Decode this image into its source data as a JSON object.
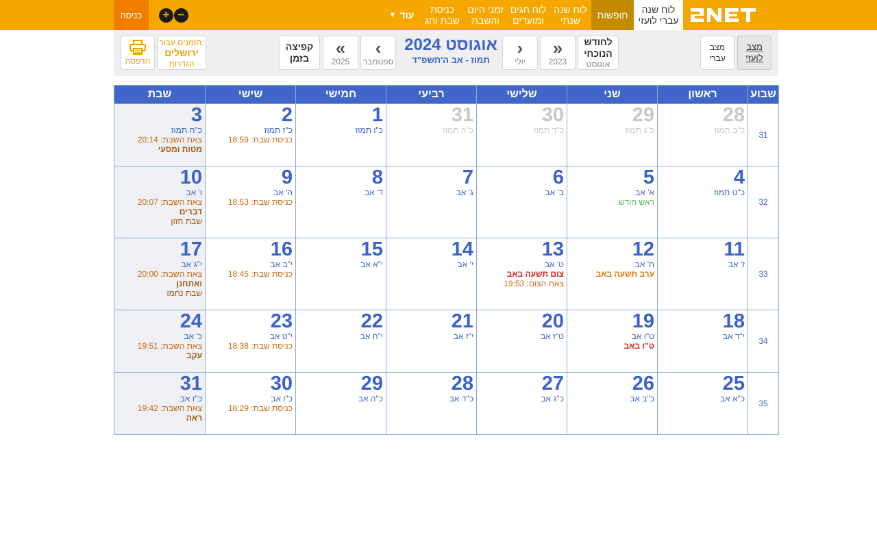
{
  "nav": {
    "items": [
      {
        "label_line1": "לוח שנה",
        "label_line2": "עברי לועזי"
      },
      {
        "label_line1": "חופשות",
        "label_line2": ""
      },
      {
        "label_line1": "לוח שנה",
        "label_line2": "שנתי"
      },
      {
        "label_line1": "לוח חגים",
        "label_line2": "ומועדים"
      },
      {
        "label_line1": "זמני היום",
        "label_line2": "והשבת"
      },
      {
        "label_line1": "כניסת",
        "label_line2": "שבת וחג"
      }
    ],
    "more_label": "עוד",
    "login_label": "כניסה",
    "zoom_in": "+",
    "zoom_out": "−"
  },
  "toolbar": {
    "mode_gregorian": {
      "line1": "מצב",
      "line2": "לועזי"
    },
    "mode_hebrew": {
      "line1": "מצב",
      "line2": "עברי"
    },
    "current_month": {
      "line1": "לחודש",
      "line2": "הנוכחי",
      "sub": "אוגוסט"
    },
    "prev_year": {
      "label": "2023"
    },
    "prev_month": {
      "label": "יולי"
    },
    "month_title": "אוגוסט 2024",
    "hebrew_range": "תמוז - אב ה'תשפ\"ד",
    "next_month": {
      "label": "ספטמבר"
    },
    "next_year": {
      "label": "2025"
    },
    "jump": {
      "line1": "קפיצה",
      "line2": "בזמן"
    },
    "location": {
      "line1": "הזמנים עבור:",
      "line2": "ירושלים",
      "line3": "הגדרות"
    },
    "print_label": "הדפסה"
  },
  "calendar": {
    "headers": [
      "שבוע",
      "ראשון",
      "שני",
      "שלישי",
      "רביעי",
      "חמישי",
      "שישי",
      "שבת"
    ],
    "weeks": [
      {
        "week": "31",
        "days": [
          {
            "num": "28",
            "heb": "כ\"ב תמוז",
            "out": true,
            "events": []
          },
          {
            "num": "29",
            "heb": "כ\"ג תמוז",
            "out": true,
            "events": []
          },
          {
            "num": "30",
            "heb": "כ\"ד תמוז",
            "out": true,
            "events": []
          },
          {
            "num": "31",
            "heb": "כ\"ה תמוז",
            "out": true,
            "events": []
          },
          {
            "num": "1",
            "heb": "כ\"ו תמוז",
            "out": false,
            "events": []
          },
          {
            "num": "2",
            "heb": "כ\"ז תמוז",
            "out": false,
            "events": [
              {
                "text": "כניסת שבת: 18:59",
                "style": "orange"
              }
            ]
          },
          {
            "num": "3",
            "heb": "כ\"ח תמוז",
            "out": false,
            "events": [
              {
                "text": "צאת השבת: 20:14",
                "style": "orange"
              },
              {
                "text": "מטות ומסעי",
                "style": "parasha"
              }
            ]
          }
        ]
      },
      {
        "week": "32",
        "days": [
          {
            "num": "4",
            "heb": "כ\"ט תמוז",
            "out": false,
            "events": []
          },
          {
            "num": "5",
            "heb": "א' אב",
            "out": false,
            "events": [
              {
                "text": "ראש חודש",
                "style": "green"
              }
            ]
          },
          {
            "num": "6",
            "heb": "ב' אב",
            "out": false,
            "events": []
          },
          {
            "num": "7",
            "heb": "ג' אב",
            "out": false,
            "events": []
          },
          {
            "num": "8",
            "heb": "ד' אב",
            "out": false,
            "events": []
          },
          {
            "num": "9",
            "heb": "ה' אב",
            "out": false,
            "events": [
              {
                "text": "כניסת שבת: 18:53",
                "style": "orange"
              }
            ]
          },
          {
            "num": "10",
            "heb": "ו' אב",
            "out": false,
            "events": [
              {
                "text": "צאת השבת: 20:07",
                "style": "orange"
              },
              {
                "text": "דברים",
                "style": "parasha"
              },
              {
                "text": "שבת חזון",
                "style": "brown"
              }
            ]
          }
        ]
      },
      {
        "week": "33",
        "days": [
          {
            "num": "11",
            "heb": "ז' אב",
            "out": false,
            "events": []
          },
          {
            "num": "12",
            "heb": "ח' אב",
            "out": false,
            "events": [
              {
                "text": "ערב תשעה באב",
                "style": "orangebold"
              }
            ]
          },
          {
            "num": "13",
            "heb": "ט' אב",
            "out": false,
            "events": [
              {
                "text": "צום תשעה באב",
                "style": "red"
              },
              {
                "text": "צאת הצום: 19:53",
                "style": "orange"
              }
            ]
          },
          {
            "num": "14",
            "heb": "י' אב",
            "out": false,
            "events": []
          },
          {
            "num": "15",
            "heb": "י\"א אב",
            "out": false,
            "events": []
          },
          {
            "num": "16",
            "heb": "י\"ב אב",
            "out": false,
            "events": [
              {
                "text": "כניסת שבת: 18:45",
                "style": "orange"
              }
            ]
          },
          {
            "num": "17",
            "heb": "י\"ג אב",
            "out": false,
            "events": [
              {
                "text": "צאת השבת: 20:00",
                "style": "orange"
              },
              {
                "text": "ואתחנן",
                "style": "parasha"
              },
              {
                "text": "שבת נחמו",
                "style": "brown"
              }
            ]
          }
        ]
      },
      {
        "week": "34",
        "days": [
          {
            "num": "18",
            "heb": "י\"ד אב",
            "out": false,
            "events": []
          },
          {
            "num": "19",
            "heb": "ט\"ו אב",
            "out": false,
            "events": [
              {
                "text": "ט\"ו באב",
                "style": "red"
              }
            ]
          },
          {
            "num": "20",
            "heb": "ט\"ז אב",
            "out": false,
            "events": []
          },
          {
            "num": "21",
            "heb": "י\"ז אב",
            "out": false,
            "events": []
          },
          {
            "num": "22",
            "heb": "י\"ח אב",
            "out": false,
            "events": []
          },
          {
            "num": "23",
            "heb": "י\"ט אב",
            "out": false,
            "events": [
              {
                "text": "כניסת שבת: 18:38",
                "style": "orange"
              }
            ]
          },
          {
            "num": "24",
            "heb": "כ' אב",
            "out": false,
            "events": [
              {
                "text": "צאת השבת: 19:51",
                "style": "orange"
              },
              {
                "text": "עקב",
                "style": "parasha"
              }
            ]
          }
        ]
      },
      {
        "week": "35",
        "days": [
          {
            "num": "25",
            "heb": "כ\"א אב",
            "out": false,
            "events": []
          },
          {
            "num": "26",
            "heb": "כ\"ב אב",
            "out": false,
            "events": []
          },
          {
            "num": "27",
            "heb": "כ\"ג אב",
            "out": false,
            "events": []
          },
          {
            "num": "28",
            "heb": "כ\"ד אב",
            "out": false,
            "events": []
          },
          {
            "num": "29",
            "heb": "כ\"ה אב",
            "out": false,
            "events": []
          },
          {
            "num": "30",
            "heb": "כ\"ו אב",
            "out": false,
            "events": [
              {
                "text": "כניסת שבת: 18:29",
                "style": "orange"
              }
            ]
          },
          {
            "num": "31",
            "heb": "כ\"ז אב",
            "out": false,
            "events": [
              {
                "text": "צאת השבת: 19:42",
                "style": "orange"
              },
              {
                "text": "ראה",
                "style": "parasha"
              }
            ]
          }
        ]
      }
    ]
  },
  "colors": {
    "brand_orange": "#f5a700",
    "login_orange": "#f07d00",
    "header_blue": "#3f66c8",
    "number_blue": "#3a62c9"
  }
}
